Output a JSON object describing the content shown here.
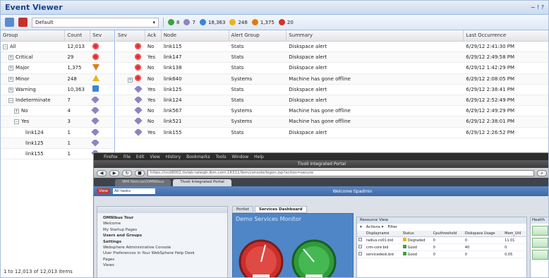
{
  "window": {
    "title": "Event Viewer",
    "controls": "− ! ?"
  },
  "toolbar": {
    "view_select": "Default",
    "summary": [
      {
        "icon": "warning-icon",
        "count": "8",
        "color": "#3aa33a"
      },
      {
        "icon": "indeterminate-icon",
        "count": "7",
        "color": "#8c84c4"
      },
      {
        "icon": "warning-icon",
        "count": "18,363",
        "color": "#3b86d4"
      },
      {
        "icon": "minor-icon",
        "count": "248",
        "color": "#e8b51c"
      },
      {
        "icon": "major-icon",
        "count": "1,375",
        "color": "#e07a12"
      },
      {
        "icon": "critical-icon",
        "count": "20",
        "color": "#d9302c"
      }
    ]
  },
  "left_grid": {
    "columns": [
      "Group",
      "Count",
      "Sev"
    ],
    "rows": [
      {
        "indent": 0,
        "expander": "−",
        "group": "All",
        "count": "12,013",
        "sev": "critical"
      },
      {
        "indent": 1,
        "expander": "+",
        "group": "Critical",
        "count": "29",
        "sev": "critical"
      },
      {
        "indent": 1,
        "expander": "+",
        "group": "Major",
        "count": "1,375",
        "sev": "major"
      },
      {
        "indent": 1,
        "expander": "+",
        "group": "Minor",
        "count": "248",
        "sev": "minor"
      },
      {
        "indent": 1,
        "expander": "+",
        "group": "Warning",
        "count": "10,363",
        "sev": "warning"
      },
      {
        "indent": 1,
        "expander": "−",
        "group": "Indeterminate",
        "count": "7",
        "sev": "indeterminate"
      },
      {
        "indent": 2,
        "expander": "+",
        "group": "No",
        "count": "4",
        "sev": "indeterminate"
      },
      {
        "indent": 2,
        "expander": "−",
        "group": "Yes",
        "count": "3",
        "sev": "indeterminate"
      },
      {
        "indent": 4,
        "expander": "",
        "group": "link124",
        "count": "1",
        "sev": "indeterminate"
      },
      {
        "indent": 4,
        "expander": "",
        "group": "link125",
        "count": "1",
        "sev": "indeterminate"
      },
      {
        "indent": 4,
        "expander": "",
        "group": "link155",
        "count": "1",
        "sev": "indeterminate"
      }
    ],
    "status": "1 to 12,013 of 12,013 items"
  },
  "right_grid": {
    "columns": [
      "Sev",
      "Ack",
      "Node",
      "Alert Group",
      "Summary",
      "Last Occurrence"
    ],
    "rows": [
      {
        "sev": "critical",
        "ack": "No",
        "node": "link115",
        "alert_group": "Stats",
        "summary": "Diskspace alert",
        "last": "6/29/12 2:41:30 PM"
      },
      {
        "sev": "critical",
        "ack": "Yes",
        "node": "link147",
        "alert_group": "Stats",
        "summary": "Diskspace alert",
        "last": "6/29/12 2:49:58 PM"
      },
      {
        "sev": "critical",
        "ack": "No",
        "node": "link138",
        "alert_group": "Stats",
        "summary": "Diskspace alert",
        "last": "6/29/12 1:42:29 PM"
      },
      {
        "sev": "critical",
        "ack": "No",
        "node": "link640",
        "alert_group": "Systems",
        "summary": "Machine has gone offline",
        "last": "6/29/12 2:08:05 PM",
        "expander": "+"
      },
      {
        "sev": "indeterminate",
        "ack": "Yes",
        "node": "link125",
        "alert_group": "Stats",
        "summary": "Diskspace alert",
        "last": "6/29/12 2:38:41 PM"
      },
      {
        "sev": "indeterminate",
        "ack": "Yes",
        "node": "link124",
        "alert_group": "Stats",
        "summary": "Diskspace alert",
        "last": "6/29/12 2:52:49 PM"
      },
      {
        "sev": "indeterminate",
        "ack": "No",
        "node": "link567",
        "alert_group": "Systems",
        "summary": "Machine has gone offline",
        "last": "6/29/12 2:49:29 PM"
      },
      {
        "sev": "indeterminate",
        "ack": "No",
        "node": "link521",
        "alert_group": "Systems",
        "summary": "Machine has gone offline",
        "last": "6/29/12 2:38:01 PM"
      },
      {
        "sev": "indeterminate",
        "ack": "Yes",
        "node": "link155",
        "alert_group": "Stats",
        "summary": "Diskspace alert",
        "last": "6/29/12 2:26:52 PM"
      }
    ]
  },
  "overlay": {
    "menubar": [
      "Firefox",
      "File",
      "Edit",
      "View",
      "History",
      "Bookmarks",
      "Tools",
      "Window",
      "Help"
    ],
    "window_title": "Tivoli Integrated Portal",
    "url": "https://ncd9001.tivlab.raleigh.ibm.com:16311/ibm/console/logon.jsp?action=secure",
    "tabs": [
      "IBM Netcool/OMNIbus",
      "Tivoli Integrated Portal"
    ],
    "app": {
      "menu_label": "View",
      "selector": "All tasks",
      "center_title": "Welcome tipadmin"
    },
    "nav_items": [
      {
        "label": "OMNIbus Tour",
        "bold": true
      },
      {
        "label": "Welcome",
        "bold": false
      },
      {
        "label": "My Startup Pages",
        "bold": false
      },
      {
        "label": "Users and Groups",
        "bold": true
      },
      {
        "label": "Settings",
        "bold": true
      },
      {
        "label": "Websphere Administrative Console",
        "bold": false
      },
      {
        "label": "User Preferences in Your WebSphere Help Desk",
        "bold": false
      },
      {
        "label": "Pages",
        "bold": false
      },
      {
        "label": "Views",
        "bold": false
      }
    ],
    "center_tabs": [
      "Portlet",
      "Services Dashboard"
    ],
    "dashboard_title": "Demo Services Monitor",
    "resource_panel": {
      "title": "Resource View",
      "tools": [
        "▾",
        "Actions ▾",
        "Filter"
      ],
      "columns": [
        "",
        "Displayname",
        "Status",
        "Cputhreshold",
        "Diskspace Usage",
        "Mem_Util"
      ],
      "rows": [
        [
          "",
          "radius-cs01.bid",
          "Degraded",
          "0",
          "0",
          "11.01"
        ],
        [
          "",
          "crm-core.bid",
          "Good",
          "0",
          "40",
          "0"
        ],
        [
          "",
          "servicedesk.bid",
          "Good",
          "0",
          "0",
          "0.05"
        ]
      ]
    },
    "far_title": "Health"
  }
}
